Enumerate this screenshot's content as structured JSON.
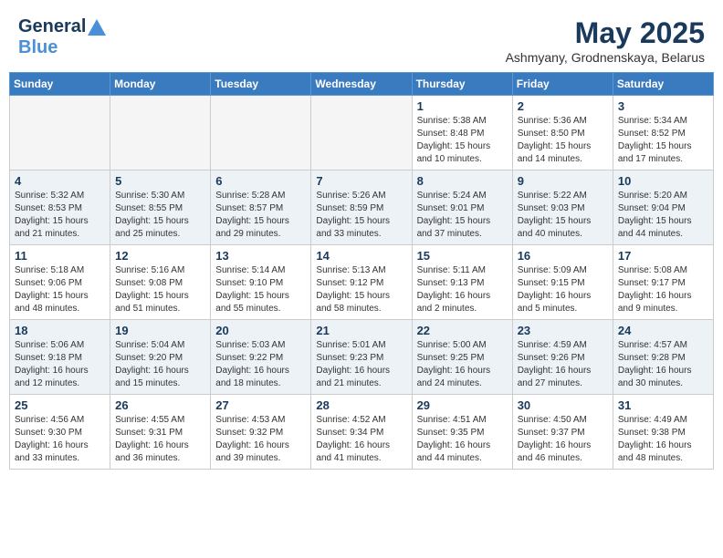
{
  "header": {
    "logo_line1": "General",
    "logo_line2": "Blue",
    "month_year": "May 2025",
    "location": "Ashmyany, Grodnenskaya, Belarus"
  },
  "weekdays": [
    "Sunday",
    "Monday",
    "Tuesday",
    "Wednesday",
    "Thursday",
    "Friday",
    "Saturday"
  ],
  "weeks": [
    [
      {
        "day": "",
        "info": ""
      },
      {
        "day": "",
        "info": ""
      },
      {
        "day": "",
        "info": ""
      },
      {
        "day": "",
        "info": ""
      },
      {
        "day": "1",
        "info": "Sunrise: 5:38 AM\nSunset: 8:48 PM\nDaylight: 15 hours\nand 10 minutes."
      },
      {
        "day": "2",
        "info": "Sunrise: 5:36 AM\nSunset: 8:50 PM\nDaylight: 15 hours\nand 14 minutes."
      },
      {
        "day": "3",
        "info": "Sunrise: 5:34 AM\nSunset: 8:52 PM\nDaylight: 15 hours\nand 17 minutes."
      }
    ],
    [
      {
        "day": "4",
        "info": "Sunrise: 5:32 AM\nSunset: 8:53 PM\nDaylight: 15 hours\nand 21 minutes."
      },
      {
        "day": "5",
        "info": "Sunrise: 5:30 AM\nSunset: 8:55 PM\nDaylight: 15 hours\nand 25 minutes."
      },
      {
        "day": "6",
        "info": "Sunrise: 5:28 AM\nSunset: 8:57 PM\nDaylight: 15 hours\nand 29 minutes."
      },
      {
        "day": "7",
        "info": "Sunrise: 5:26 AM\nSunset: 8:59 PM\nDaylight: 15 hours\nand 33 minutes."
      },
      {
        "day": "8",
        "info": "Sunrise: 5:24 AM\nSunset: 9:01 PM\nDaylight: 15 hours\nand 37 minutes."
      },
      {
        "day": "9",
        "info": "Sunrise: 5:22 AM\nSunset: 9:03 PM\nDaylight: 15 hours\nand 40 minutes."
      },
      {
        "day": "10",
        "info": "Sunrise: 5:20 AM\nSunset: 9:04 PM\nDaylight: 15 hours\nand 44 minutes."
      }
    ],
    [
      {
        "day": "11",
        "info": "Sunrise: 5:18 AM\nSunset: 9:06 PM\nDaylight: 15 hours\nand 48 minutes."
      },
      {
        "day": "12",
        "info": "Sunrise: 5:16 AM\nSunset: 9:08 PM\nDaylight: 15 hours\nand 51 minutes."
      },
      {
        "day": "13",
        "info": "Sunrise: 5:14 AM\nSunset: 9:10 PM\nDaylight: 15 hours\nand 55 minutes."
      },
      {
        "day": "14",
        "info": "Sunrise: 5:13 AM\nSunset: 9:12 PM\nDaylight: 15 hours\nand 58 minutes."
      },
      {
        "day": "15",
        "info": "Sunrise: 5:11 AM\nSunset: 9:13 PM\nDaylight: 16 hours\nand 2 minutes."
      },
      {
        "day": "16",
        "info": "Sunrise: 5:09 AM\nSunset: 9:15 PM\nDaylight: 16 hours\nand 5 minutes."
      },
      {
        "day": "17",
        "info": "Sunrise: 5:08 AM\nSunset: 9:17 PM\nDaylight: 16 hours\nand 9 minutes."
      }
    ],
    [
      {
        "day": "18",
        "info": "Sunrise: 5:06 AM\nSunset: 9:18 PM\nDaylight: 16 hours\nand 12 minutes."
      },
      {
        "day": "19",
        "info": "Sunrise: 5:04 AM\nSunset: 9:20 PM\nDaylight: 16 hours\nand 15 minutes."
      },
      {
        "day": "20",
        "info": "Sunrise: 5:03 AM\nSunset: 9:22 PM\nDaylight: 16 hours\nand 18 minutes."
      },
      {
        "day": "21",
        "info": "Sunrise: 5:01 AM\nSunset: 9:23 PM\nDaylight: 16 hours\nand 21 minutes."
      },
      {
        "day": "22",
        "info": "Sunrise: 5:00 AM\nSunset: 9:25 PM\nDaylight: 16 hours\nand 24 minutes."
      },
      {
        "day": "23",
        "info": "Sunrise: 4:59 AM\nSunset: 9:26 PM\nDaylight: 16 hours\nand 27 minutes."
      },
      {
        "day": "24",
        "info": "Sunrise: 4:57 AM\nSunset: 9:28 PM\nDaylight: 16 hours\nand 30 minutes."
      }
    ],
    [
      {
        "day": "25",
        "info": "Sunrise: 4:56 AM\nSunset: 9:30 PM\nDaylight: 16 hours\nand 33 minutes."
      },
      {
        "day": "26",
        "info": "Sunrise: 4:55 AM\nSunset: 9:31 PM\nDaylight: 16 hours\nand 36 minutes."
      },
      {
        "day": "27",
        "info": "Sunrise: 4:53 AM\nSunset: 9:32 PM\nDaylight: 16 hours\nand 39 minutes."
      },
      {
        "day": "28",
        "info": "Sunrise: 4:52 AM\nSunset: 9:34 PM\nDaylight: 16 hours\nand 41 minutes."
      },
      {
        "day": "29",
        "info": "Sunrise: 4:51 AM\nSunset: 9:35 PM\nDaylight: 16 hours\nand 44 minutes."
      },
      {
        "day": "30",
        "info": "Sunrise: 4:50 AM\nSunset: 9:37 PM\nDaylight: 16 hours\nand 46 minutes."
      },
      {
        "day": "31",
        "info": "Sunrise: 4:49 AM\nSunset: 9:38 PM\nDaylight: 16 hours\nand 48 minutes."
      }
    ]
  ]
}
